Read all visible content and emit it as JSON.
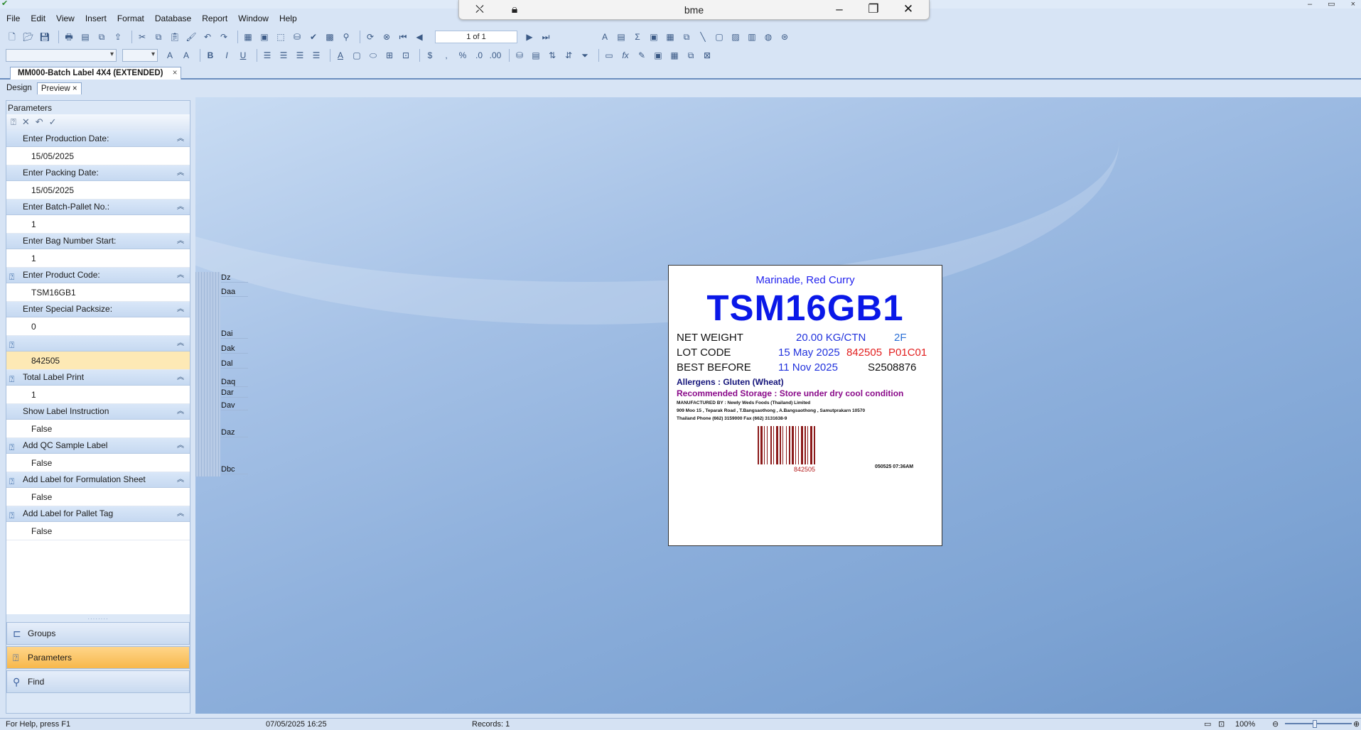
{
  "window": {
    "remote_title": "bme",
    "app_controls": [
      "–",
      "▭",
      "×"
    ]
  },
  "menu": [
    "File",
    "Edit",
    "View",
    "Insert",
    "Format",
    "Database",
    "Report",
    "Window",
    "Help"
  ],
  "toolbar": {
    "page_indicator": "1 of 1"
  },
  "document_tab": {
    "title": "MM000-Batch Label 4X4 (EXTENDED)",
    "close": "×"
  },
  "view_tabs": {
    "design": "Design",
    "preview": "Preview",
    "preview_close": "×"
  },
  "panel": {
    "title": "Parameters",
    "params": [
      {
        "label": "Enter Production Date:",
        "value": "15/05/2025",
        "linked": false
      },
      {
        "label": "Enter Packing Date:",
        "value": "15/05/2025",
        "linked": false
      },
      {
        "label": "Enter Batch-Pallet No.:",
        "value": "1",
        "linked": false
      },
      {
        "label": "Enter Bag Number Start:",
        "value": "1",
        "linked": false
      },
      {
        "label": "Enter Product Code:",
        "value": "TSM16GB1",
        "linked": true
      },
      {
        "label": "Enter Special Packsize:",
        "value": "0",
        "linked": false
      },
      {
        "label": "",
        "value": "842505",
        "linked": true
      },
      {
        "label": "Total Label Print",
        "value": "1",
        "linked": true
      },
      {
        "label": "Show Label Instruction",
        "value": "False",
        "linked": false
      },
      {
        "label": "Add QC Sample Label",
        "value": "False",
        "linked": true
      },
      {
        "label": "Add Label for Formulation Sheet",
        "value": "False",
        "linked": true
      },
      {
        "label": "Add Label for Pallet Tag",
        "value": "False",
        "linked": true
      }
    ],
    "nav": {
      "groups": "Groups",
      "parameters": "Parameters",
      "find": "Find"
    }
  },
  "guides": [
    "Dz",
    "Daa",
    "Dai",
    "Dak",
    "Dal",
    "Daq",
    "Dar",
    "Dav",
    "Daz",
    "Dbc"
  ],
  "label": {
    "product_name": "Marinade, Red Curry",
    "product_code": "TSM16GB1",
    "net_weight_label": "NET WEIGHT",
    "net_weight_value": "20.00 KG/CTN",
    "net_weight_code": "2F",
    "lot_code_label": "LOT CODE",
    "lot_date": "15 May 2025",
    "lot_number": "842505",
    "lot_suffix": "P01C01",
    "best_before_label": "BEST BEFORE",
    "best_before_value": "11 Nov 2025",
    "best_before_code": "S2508876",
    "allergens": "Allergens : Gluten (Wheat)",
    "storage": "Recommended Storage :  Store under dry cool condition",
    "mfg_line1": "MANUFACTURED BY : Newly Weds Foods (Thailand) Limited",
    "mfg_line2": "909 Moo 15 , Teparak Road , T.Bangsaothong , A.Bangsaothong , Samutprakarn  10570",
    "mfg_line3": "Thailand Phone (662) 3159000 Fax (662) 3131638-9",
    "barcode_number": "842505",
    "print_timestamp": "050525 07:36AM"
  },
  "status": {
    "help": "For Help, press F1",
    "datetime": "07/05/2025  16:25",
    "records": "Records:  1",
    "zoom": "100%"
  }
}
